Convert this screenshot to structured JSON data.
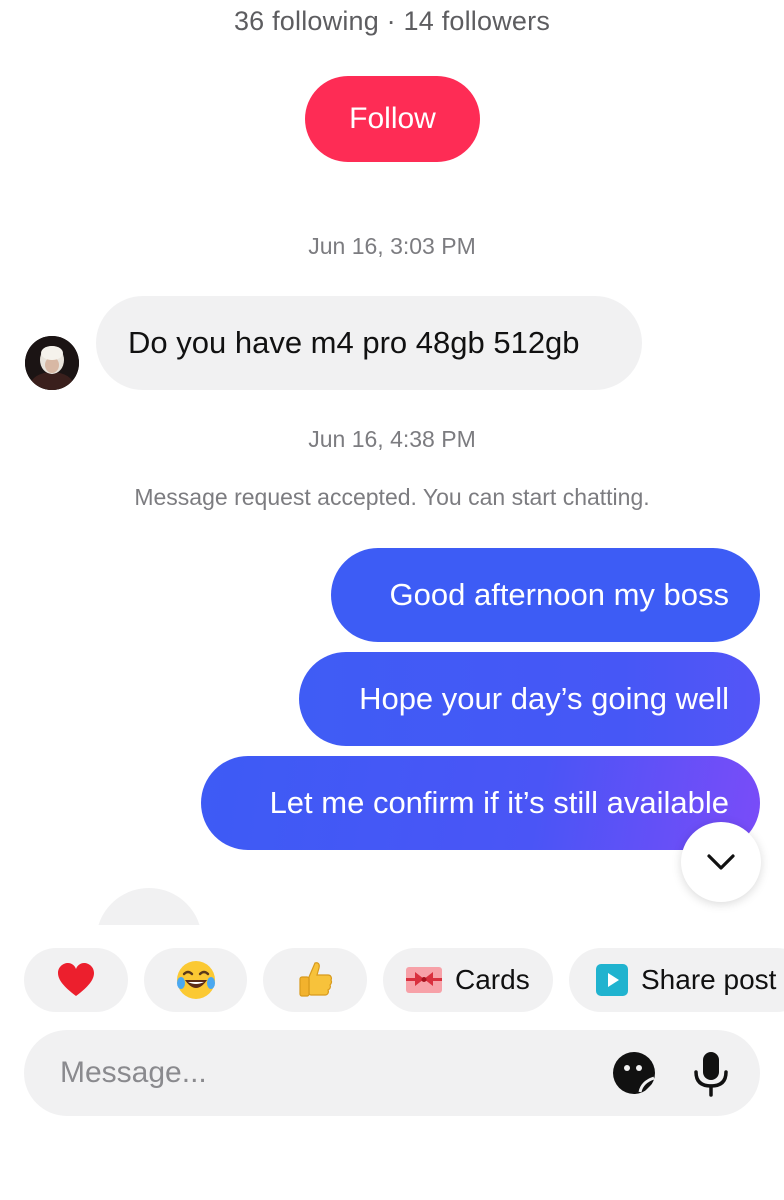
{
  "profile": {
    "stats_text": "36 following · 14 followers",
    "follow_label": "Follow"
  },
  "conversation": {
    "timestamp_1": "Jun 16, 3:03 PM",
    "incoming_message": "Do you have m4 pro 48gb 512gb",
    "timestamp_2": "Jun 16, 4:38 PM",
    "system_message": "Message request accepted. You can start chatting.",
    "outgoing_messages": [
      "Good afternoon my boss",
      "Hope your day’s going well",
      "Let me confirm if it’s still available"
    ]
  },
  "quick_actions": {
    "reactions": [
      "heart-emoji",
      "laughing-emoji",
      "thumbs-up-emoji"
    ],
    "cards_label": "Cards",
    "share_post_label": "Share post"
  },
  "composer": {
    "placeholder": "Message..."
  },
  "colors": {
    "follow_button": "#fe2c55",
    "outgoing_bubble": "#3d5cf5",
    "outgoing_bubble_accent": "#7a4cf8",
    "incoming_bubble": "#f1f1f2"
  }
}
